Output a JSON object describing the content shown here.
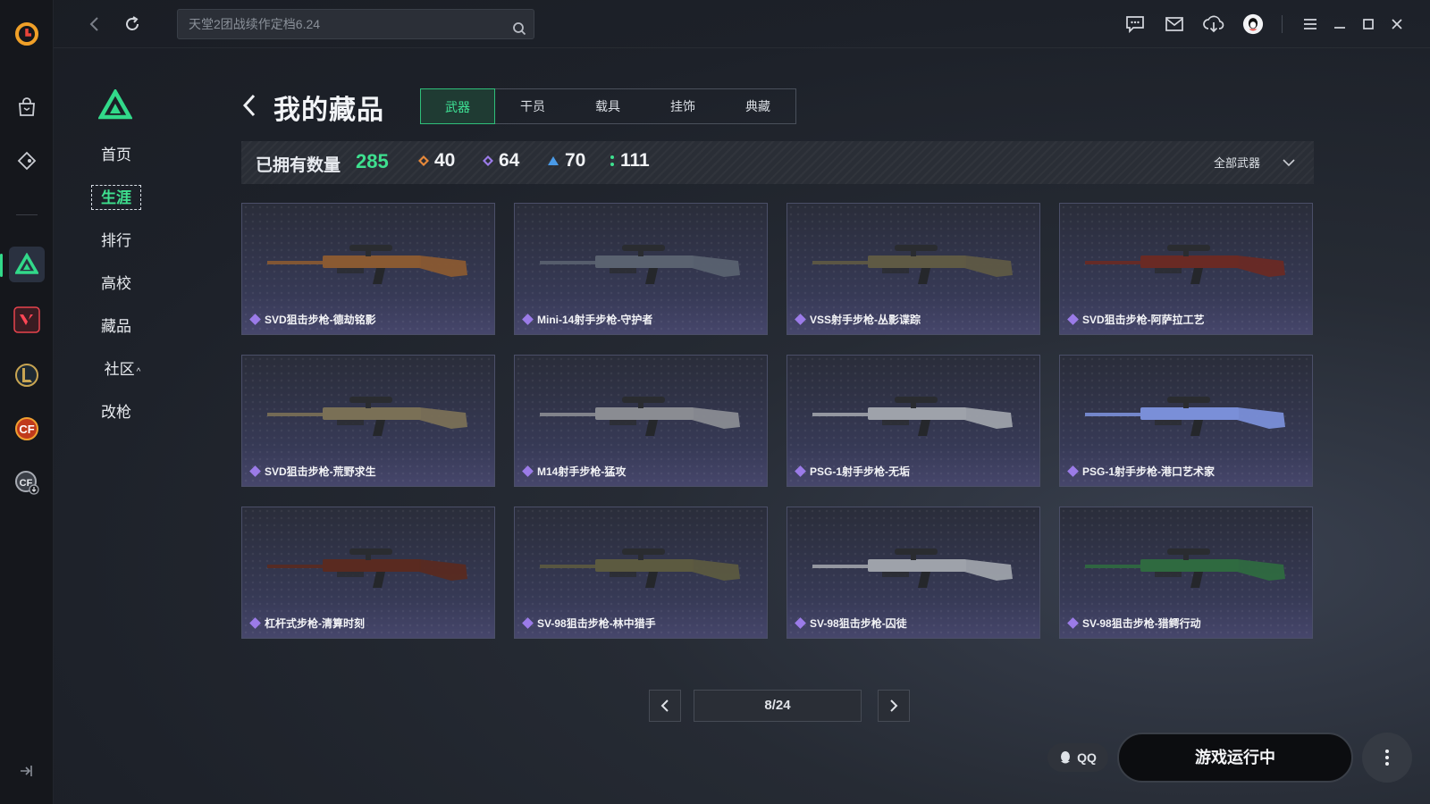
{
  "search": {
    "value": "天堂2团战续作定档6.24"
  },
  "nav": {
    "items": [
      {
        "label": "首页"
      },
      {
        "label": "生涯"
      },
      {
        "label": "排行"
      },
      {
        "label": "高校"
      },
      {
        "label": "藏品"
      },
      {
        "label": "社区"
      },
      {
        "label": "改枪"
      }
    ],
    "active": "生涯"
  },
  "page": {
    "title": "我的藏品"
  },
  "tabs": [
    {
      "label": "武器"
    },
    {
      "label": "干员"
    },
    {
      "label": "载具"
    },
    {
      "label": "挂饰"
    },
    {
      "label": "典藏"
    }
  ],
  "stats": {
    "label": "已拥有数量",
    "total": "285",
    "counts": [
      {
        "value": "40",
        "color": "#e8893a"
      },
      {
        "value": "64",
        "color": "#9b7be8"
      },
      {
        "value": "70",
        "color": "#4a9be8"
      },
      {
        "value": "111",
        "color": "#3ee08f"
      }
    ],
    "filter": "全部武器"
  },
  "cards": [
    {
      "name": "SVD狙击步枪-德劫铭影",
      "color": "#8a5a32"
    },
    {
      "name": "Mini-14射手步枪-守护者",
      "color": "#5a6270"
    },
    {
      "name": "VSS射手步枪-丛影谍踪",
      "color": "#5f5a44"
    },
    {
      "name": "SVD狙击步枪-阿萨拉工艺",
      "color": "#6a2a24"
    },
    {
      "name": "SVD狙击步枪-荒野求生",
      "color": "#7a7056"
    },
    {
      "name": "M14射手步枪-猛攻",
      "color": "#8a8c92"
    },
    {
      "name": "PSG-1射手步枪-无垢",
      "color": "#9ea2aa"
    },
    {
      "name": "PSG-1射手步枪-港口艺术家",
      "color": "#7a8fd8"
    },
    {
      "name": "杠杆式步枪-清算时刻",
      "color": "#5a2a20"
    },
    {
      "name": "SV-98狙击步枪-林中猎手",
      "color": "#5c5a40"
    },
    {
      "name": "SV-98狙击步枪-囚徒",
      "color": "#9ea2aa"
    },
    {
      "name": "SV-98狙击步枪-猎鳄行动",
      "color": "#2f6a40"
    }
  ],
  "pagination": {
    "text": "8/24"
  },
  "bottom": {
    "qq": "QQ",
    "run": "游戏运行中"
  }
}
